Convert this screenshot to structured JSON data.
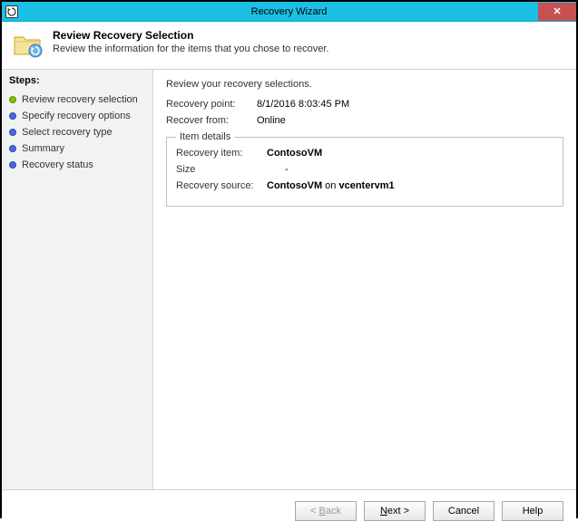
{
  "window": {
    "title": "Recovery Wizard"
  },
  "header": {
    "title": "Review Recovery Selection",
    "subtitle": "Review the information for the items that you chose to recover."
  },
  "sidebar": {
    "heading": "Steps:",
    "items": [
      "Review recovery selection",
      "Specify recovery options",
      "Select recovery type",
      "Summary",
      "Recovery status"
    ]
  },
  "main": {
    "instruction": "Review your recovery selections.",
    "recovery_point": {
      "label": "Recovery point:",
      "value": "8/1/2016 8:03:45 PM"
    },
    "recover_from": {
      "label": "Recover from:",
      "value": "Online"
    },
    "item_details": {
      "legend": "Item details",
      "recovery_item": {
        "label": "Recovery item:",
        "value": "ContosoVM"
      },
      "size": {
        "label": "Size",
        "value": "-"
      },
      "recovery_source": {
        "label": "Recovery source:",
        "value": "ContosoVM on vcentervm1"
      }
    }
  },
  "footer": {
    "back": "< Back",
    "next": "Next >",
    "cancel": "Cancel",
    "help": "Help"
  }
}
